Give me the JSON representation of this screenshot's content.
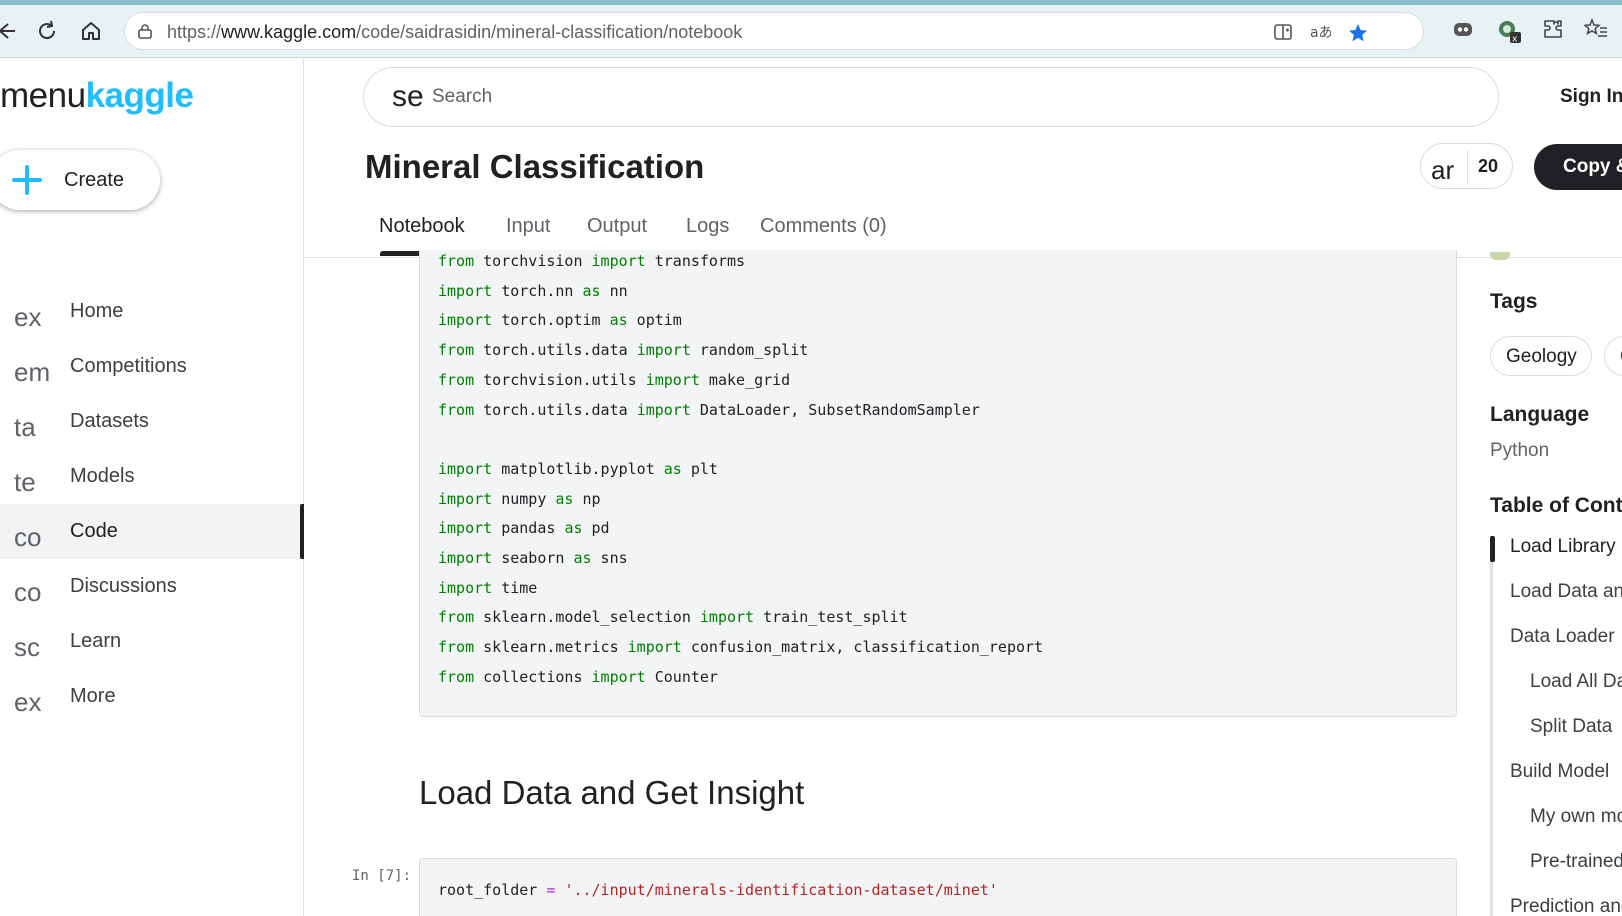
{
  "browser": {
    "url_prefix": "https://",
    "url_host": "www.kaggle.com",
    "url_path": "/code/saidrasidin/mineral-classification/notebook"
  },
  "sidebar": {
    "brand_menu": "menu",
    "brand_name": "kaggle",
    "create_label": "Create",
    "items": [
      {
        "icon": "ex",
        "label": "Home"
      },
      {
        "icon": "em",
        "label": "Competitions"
      },
      {
        "icon": "ta",
        "label": "Datasets"
      },
      {
        "icon": "te",
        "label": "Models"
      },
      {
        "icon": "co",
        "label": "Code"
      },
      {
        "icon": "co",
        "label": "Discussions"
      },
      {
        "icon": "sc",
        "label": "Learn"
      },
      {
        "icon": "ex",
        "label": "More"
      }
    ]
  },
  "header": {
    "search_icon_text": "se",
    "search_placeholder": "Search",
    "sign_in": "Sign In",
    "title": "Mineral Classification",
    "vote_icon_text": "ar",
    "vote_count": "20",
    "copy_label": "Copy &"
  },
  "tabs": [
    "Notebook",
    "Input",
    "Output",
    "Logs",
    "Comments (0)"
  ],
  "notebook": {
    "code_cell_1": [
      [
        {
          "k": "from"
        },
        {
          "t": " torchvision "
        },
        {
          "k": "import"
        },
        {
          "t": " transforms"
        }
      ],
      [
        {
          "k": "import"
        },
        {
          "t": " torch.nn "
        },
        {
          "k": "as"
        },
        {
          "t": " nn"
        }
      ],
      [
        {
          "k": "import"
        },
        {
          "t": " torch.optim "
        },
        {
          "k": "as"
        },
        {
          "t": " optim"
        }
      ],
      [
        {
          "k": "from"
        },
        {
          "t": " torch.utils.data "
        },
        {
          "k": "import"
        },
        {
          "t": " random_split"
        }
      ],
      [
        {
          "k": "from"
        },
        {
          "t": " torchvision.utils "
        },
        {
          "k": "import"
        },
        {
          "t": " make_grid"
        }
      ],
      [
        {
          "k": "from"
        },
        {
          "t": " torch.utils.data "
        },
        {
          "k": "import"
        },
        {
          "t": " DataLoader, SubsetRandomSampler"
        }
      ],
      [],
      [
        {
          "k": "import"
        },
        {
          "t": " matplotlib.pyplot "
        },
        {
          "k": "as"
        },
        {
          "t": " plt"
        }
      ],
      [
        {
          "k": "import"
        },
        {
          "t": " numpy "
        },
        {
          "k": "as"
        },
        {
          "t": " np"
        }
      ],
      [
        {
          "k": "import"
        },
        {
          "t": " pandas "
        },
        {
          "k": "as"
        },
        {
          "t": " pd"
        }
      ],
      [
        {
          "k": "import"
        },
        {
          "t": " seaborn "
        },
        {
          "k": "as"
        },
        {
          "t": " sns"
        }
      ],
      [
        {
          "k": "import"
        },
        {
          "t": " time"
        }
      ],
      [
        {
          "k": "from"
        },
        {
          "t": " sklearn.model_selection "
        },
        {
          "k": "import"
        },
        {
          "t": " train_test_split"
        }
      ],
      [
        {
          "k": "from"
        },
        {
          "t": " sklearn.metrics "
        },
        {
          "k": "import"
        },
        {
          "t": " confusion_matrix, classification_report"
        }
      ],
      [
        {
          "k": "from"
        },
        {
          "t": " collections "
        },
        {
          "k": "import"
        },
        {
          "t": " Counter"
        }
      ]
    ],
    "markdown_heading": "Load Data and Get Insight",
    "cell_2_prompt": "In [7]:",
    "code_cell_2": [
      [
        {
          "t": "root_folder "
        },
        {
          "o": "="
        },
        {
          "t": " "
        },
        {
          "s": "'../input/minerals-identification-dataset/minet'"
        }
      ]
    ]
  },
  "right_panel": {
    "tags_heading": "Tags",
    "tags": [
      "Geology",
      "C"
    ],
    "language_heading": "Language",
    "language": "Python",
    "toc_heading": "Table of Conte",
    "toc": [
      {
        "label": "Load Library",
        "level": 1,
        "active": true
      },
      {
        "label": "Load Data and",
        "level": 1,
        "active": false
      },
      {
        "label": "Data Loader",
        "level": 1,
        "active": false
      },
      {
        "label": "Load All Da",
        "level": 2,
        "active": false
      },
      {
        "label": "Split Data",
        "level": 2,
        "active": false
      },
      {
        "label": "Build Model",
        "level": 1,
        "active": false
      },
      {
        "label": "My own mo",
        "level": 2,
        "active": false
      },
      {
        "label": "Pre-trained",
        "level": 2,
        "active": false
      },
      {
        "label": "Prediction and",
        "level": 1,
        "active": false
      }
    ]
  },
  "colors": {
    "kaggle_blue": "#20beff",
    "keyword_green": "#008000",
    "string_red": "#ba2121",
    "operator_purple": "#aa22ff",
    "favorite_star": "#1a73e8"
  }
}
